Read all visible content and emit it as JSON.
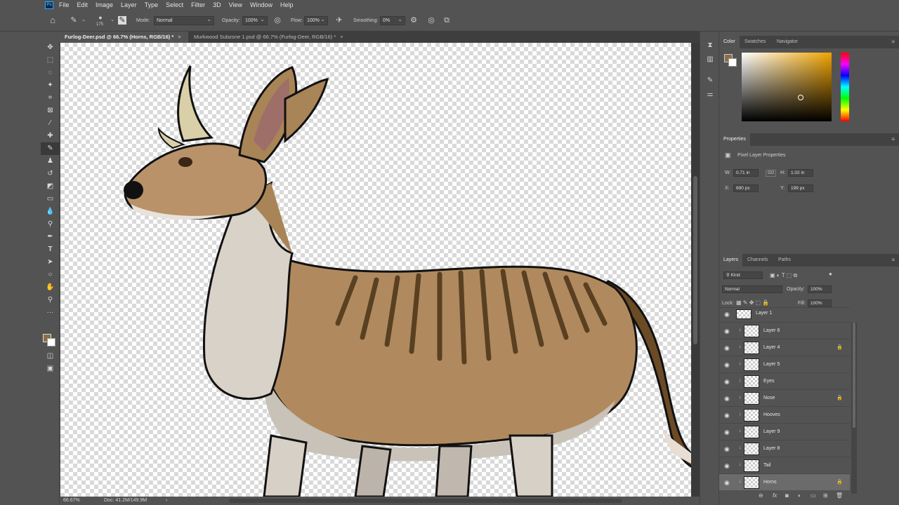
{
  "menu": {
    "app_icon": "Ps",
    "items": [
      "File",
      "Edit",
      "Image",
      "Layer",
      "Type",
      "Select",
      "Filter",
      "3D",
      "View",
      "Window",
      "Help"
    ]
  },
  "options": {
    "brush_size": "175",
    "mode_label": "Mode:",
    "mode_value": "Normal",
    "opacity_label": "Opacity:",
    "opacity_value": "100%",
    "flow_label": "Flow:",
    "flow_value": "100%",
    "smoothing_label": "Smoothing:",
    "smoothing_value": "0%"
  },
  "tabs": [
    {
      "label": "Furlog-Deer.psd @ 66.7% (Horns, RGB/16) *",
      "close": "×"
    },
    {
      "label": "Murkwood Subzone 1.psd @ 66.7% (Furlog-Deer, RGB/16) *",
      "close": "×"
    }
  ],
  "status": {
    "zoom": "66.67%",
    "doc": "Doc: 41.2M/149.9M",
    "arrow": "›"
  },
  "color_panel": {
    "tabs": [
      "Color",
      "Swatches",
      "Navigator"
    ],
    "foreground_color": "#8a7048",
    "background_color": "#ffffff"
  },
  "properties": {
    "title": "Properties",
    "subtitle": "Pixel Layer Properties",
    "w_label": "W:",
    "w_value": "0.71 in",
    "h_label": "H:",
    "h_value": "1.02 in",
    "x_label": "X:",
    "x_value": "690 px",
    "y_label": "Y:",
    "y_value": "199 px",
    "link_icon": "GO"
  },
  "layers": {
    "tabs": [
      "Layers",
      "Channels",
      "Paths"
    ],
    "filter_value": "Kind",
    "blend_value": "Normal",
    "opacity_label": "Opacity:",
    "opacity_value": "100%",
    "lock_label": "Lock:",
    "fill_label": "Fill:",
    "fill_value": "100%",
    "items": [
      {
        "name": "Layer 1",
        "locked": false
      },
      {
        "name": "Layer 6",
        "locked": false
      },
      {
        "name": "Layer 4",
        "locked": true
      },
      {
        "name": "Layer 5",
        "locked": false
      },
      {
        "name": "Eyes",
        "locked": false
      },
      {
        "name": "Nose",
        "locked": true
      },
      {
        "name": "Hooves",
        "locked": false
      },
      {
        "name": "Layer 9",
        "locked": false
      },
      {
        "name": "Layer 8",
        "locked": false
      },
      {
        "name": "Tail",
        "locked": false
      },
      {
        "name": "Horns",
        "locked": true
      }
    ]
  }
}
